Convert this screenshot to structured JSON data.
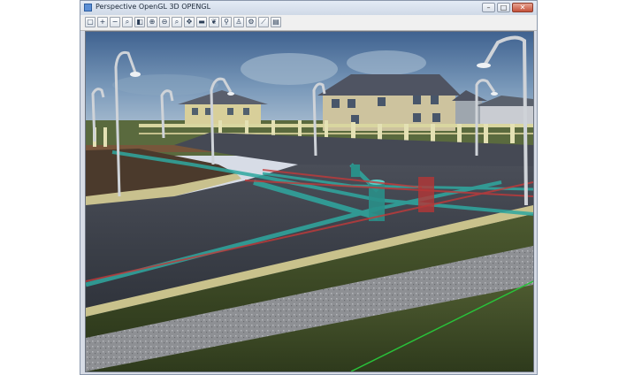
{
  "window": {
    "title": "Perspective OpenGL 3D OPENGL",
    "controls": {
      "minimize": "–",
      "maximize": "□",
      "close": "✕"
    }
  },
  "toolbar": {
    "buttons": [
      {
        "name": "new-icon",
        "glyph": "▢"
      },
      {
        "name": "zoom-in-icon",
        "glyph": "+"
      },
      {
        "name": "zoom-out-icon",
        "glyph": "−"
      },
      {
        "name": "zoom-icon",
        "glyph": "⌕"
      },
      {
        "name": "color-icon",
        "glyph": "◧"
      },
      {
        "name": "zoom-window-icon",
        "glyph": "⊕"
      },
      {
        "name": "zoom-extents-icon",
        "glyph": "⊖"
      },
      {
        "name": "search-icon",
        "glyph": "⌕"
      },
      {
        "name": "pan-icon",
        "glyph": "✥"
      },
      {
        "name": "car-icon",
        "glyph": "▬"
      },
      {
        "name": "leaf-icon",
        "glyph": "❦"
      },
      {
        "name": "walk-icon",
        "glyph": "⚲"
      },
      {
        "name": "person-icon",
        "glyph": "♙"
      },
      {
        "name": "settings-icon",
        "glyph": "⚙"
      },
      {
        "name": "measure-icon",
        "glyph": "⟋"
      },
      {
        "name": "print-icon",
        "glyph": "▤"
      }
    ]
  },
  "colors": {
    "sky": "#5b7ea6",
    "road": "#3b3f48",
    "grass": "#3c4a26",
    "gravel": "#8f9195",
    "pipe_cyan": "#2fa8a0",
    "pipe_red": "#c23a3a"
  }
}
